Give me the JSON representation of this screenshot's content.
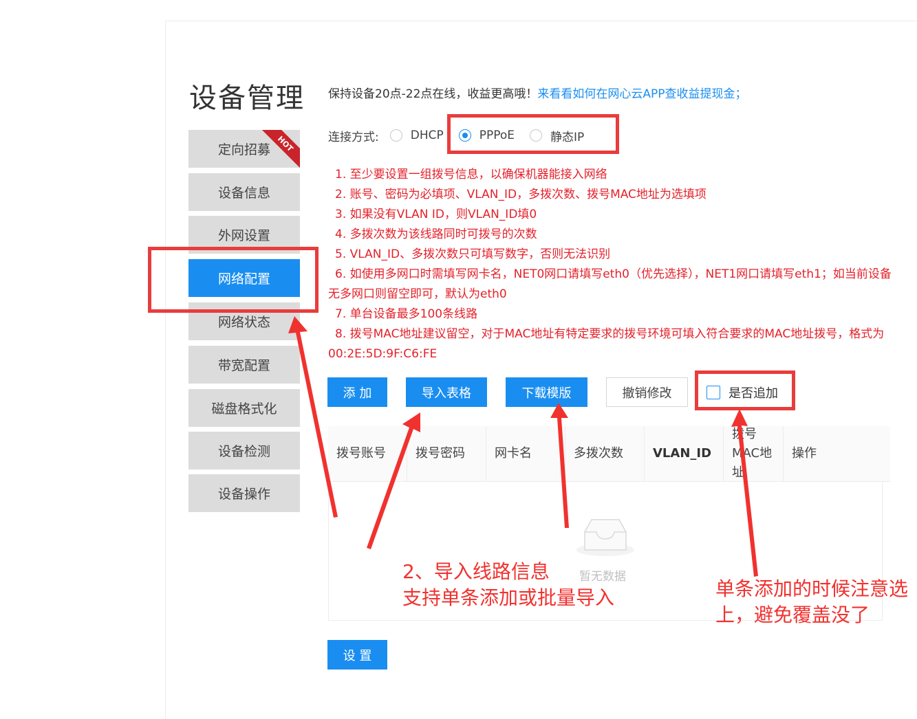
{
  "page": {
    "title": "设备管理"
  },
  "sidebar": {
    "items": [
      {
        "label": "定向招募",
        "badge": "HOT",
        "active": false
      },
      {
        "label": "设备信息",
        "active": false
      },
      {
        "label": "外网设置",
        "active": false
      },
      {
        "label": "网络配置",
        "active": true
      },
      {
        "label": "网络状态",
        "active": false
      },
      {
        "label": "带宽配置",
        "active": false
      },
      {
        "label": "磁盘格式化",
        "active": false
      },
      {
        "label": "设备检测",
        "active": false
      },
      {
        "label": "设备操作",
        "active": false
      }
    ]
  },
  "notice": {
    "text": "保持设备20点-22点在线，收益更高哦！",
    "link": "来看看如何在网心云APP查收益提现金；"
  },
  "connection": {
    "label": "连接方式:",
    "options": [
      {
        "label": "DHCP",
        "checked": false
      },
      {
        "label": "PPPoE",
        "checked": true
      },
      {
        "label": "静态IP",
        "checked": false
      }
    ]
  },
  "rules": [
    "1. 至少要设置一组拨号信息，以确保机器能接入网络",
    "2. 账号、密码为必填项、VLAN_ID，多拨次数、拨号MAC地址为选填项",
    "3. 如果没有VLAN ID，则VLAN_ID填0",
    "4. 多拨次数为该线路同时可拨号的次数",
    "5. VLAN_ID、多拨次数只可填写数字，否则无法识别",
    "6. 如使用多网口时需填写网卡名，NET0网口请填写eth0（优先选择），NET1网口请填写eth1；如当前设备无多网口则留空即可，默认为eth0",
    "7. 单台设备最多100条线路",
    "8. 拨号MAC地址建议留空，对于MAC地址有特定要求的拨号环境可填入符合要求的MAC地址拨号，格式为00:2E:5D:9F:C6:FE"
  ],
  "toolbar": {
    "add": "添 加",
    "import": "导入表格",
    "download": "下载模版",
    "undo": "撤销修改",
    "append": "是否追加"
  },
  "table": {
    "columns": [
      "拨号账号",
      "拨号密码",
      "网卡名",
      "多拨次数",
      "VLAN_ID",
      "拨号MAC地址",
      "操作"
    ],
    "empty": "暂无数据"
  },
  "submit": "设 置",
  "annotations": {
    "import_note_line1": "2、导入线路信息",
    "import_note_line2": "支持单条添加或批量导入",
    "append_note_line1": "单条添加的时候注意选",
    "append_note_line2": "上，避免覆盖没了"
  },
  "colors": {
    "primary": "#1a8ef0",
    "rules_red": "#e4212a",
    "annotation_red": "#e93c3c",
    "sidebar_bg": "#dcdcdc"
  }
}
